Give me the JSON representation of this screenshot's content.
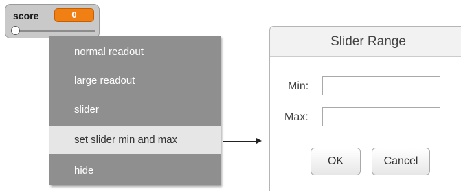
{
  "watcher": {
    "label": "score",
    "value": "0",
    "slider_value_fraction": 0,
    "value_color": "#f07f14"
  },
  "context_menu": {
    "items": [
      {
        "label": "normal readout",
        "selected": false
      },
      {
        "label": "large readout",
        "selected": false
      },
      {
        "label": "slider",
        "selected": false
      },
      {
        "label": "set slider min and max",
        "selected": true
      },
      {
        "label": "hide",
        "selected": false
      }
    ]
  },
  "arrow_icon": "arrow-right-icon",
  "dialog": {
    "title": "Slider Range",
    "min_label": "Min:",
    "min_value": "",
    "max_label": "Max:",
    "max_value": "",
    "ok_label": "OK",
    "cancel_label": "Cancel"
  }
}
